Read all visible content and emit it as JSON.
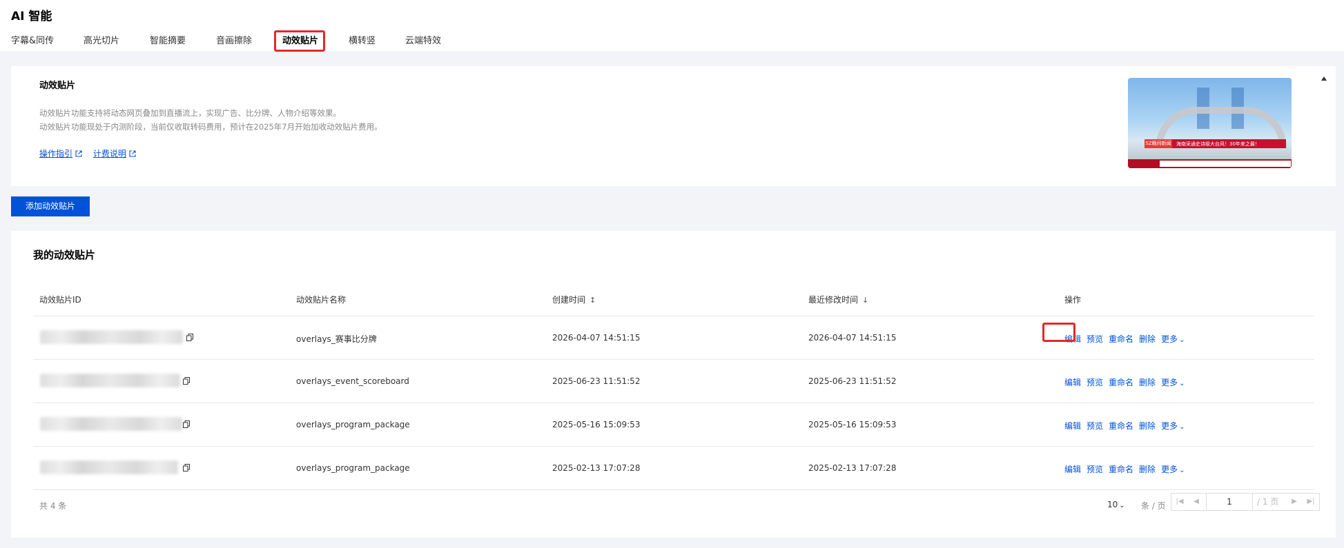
{
  "app": {
    "title": "AI 智能"
  },
  "tabs": [
    {
      "label": "字幕&同传"
    },
    {
      "label": "高光切片"
    },
    {
      "label": "智能摘要"
    },
    {
      "label": "音画擦除"
    },
    {
      "label": "动效贴片",
      "active": true
    },
    {
      "label": "横转竖"
    },
    {
      "label": "云端特效"
    }
  ],
  "info": {
    "title": "动效贴片",
    "desc_line1": "动效贴片功能支持将动态网页叠加到直播流上，实现广告、比分牌、人物介绍等效果。",
    "desc_line2": "动效贴片功能现处于内测阶段，当前仅收取转码费用，预计在2025年7月开始加收动效贴片费用。",
    "link_guide": "操作指引",
    "link_billing": "计费说明",
    "preview_badge": "SZ晚间新闻",
    "preview_headline": "海南采通史诗级大台风！30年来之最！"
  },
  "toolbar": {
    "add_button": "添加动效贴片"
  },
  "list": {
    "title": "我的动效贴片",
    "columns": {
      "id": "动效贴片ID",
      "name": "动效贴片名称",
      "created": "创建时间",
      "modified": "最近修改时间",
      "actions": "操作"
    },
    "action_labels": {
      "edit": "编辑",
      "preview": "预览",
      "rename": "重命名",
      "delete": "删除",
      "more": "更多"
    },
    "rows": [
      {
        "name": "overlays_赛事比分牌",
        "created": "2026-04-07 14:51:15",
        "modified": "2026-04-07 14:51:15"
      },
      {
        "name": "overlays_event_scoreboard",
        "created": "2025-06-23 11:51:52",
        "modified": "2025-06-23 11:51:52"
      },
      {
        "name": "overlays_program_package",
        "created": "2025-05-16 15:09:53",
        "modified": "2025-05-16 15:09:53"
      },
      {
        "name": "overlays_program_package",
        "created": "2025-02-13 17:07:28",
        "modified": "2025-02-13 17:07:28"
      }
    ]
  },
  "footer": {
    "total": "共 4 条",
    "page_size": "10",
    "page_size_unit": "条 / 页",
    "current_page": "1",
    "total_pages": "/ 1 页"
  },
  "colors": {
    "primary": "#0052d9",
    "highlight": "#e0292b"
  }
}
